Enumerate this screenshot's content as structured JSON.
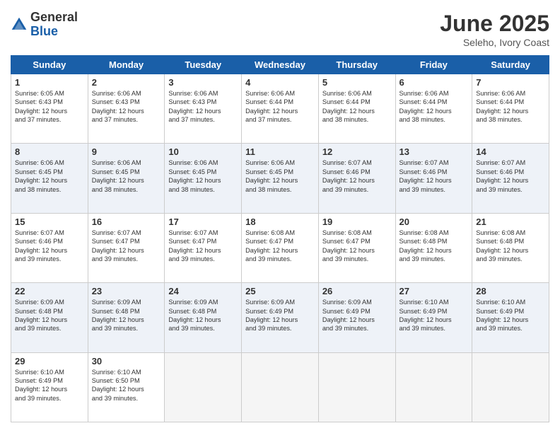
{
  "header": {
    "logo_general": "General",
    "logo_blue": "Blue",
    "month_title": "June 2025",
    "location": "Seleho, Ivory Coast"
  },
  "weekdays": [
    "Sunday",
    "Monday",
    "Tuesday",
    "Wednesday",
    "Thursday",
    "Friday",
    "Saturday"
  ],
  "weeks": [
    [
      {
        "day": "1",
        "sunrise": "6:05 AM",
        "sunset": "6:43 PM",
        "daylight": "12 hours and 37 minutes."
      },
      {
        "day": "2",
        "sunrise": "6:06 AM",
        "sunset": "6:43 PM",
        "daylight": "12 hours and 37 minutes."
      },
      {
        "day": "3",
        "sunrise": "6:06 AM",
        "sunset": "6:43 PM",
        "daylight": "12 hours and 37 minutes."
      },
      {
        "day": "4",
        "sunrise": "6:06 AM",
        "sunset": "6:44 PM",
        "daylight": "12 hours and 37 minutes."
      },
      {
        "day": "5",
        "sunrise": "6:06 AM",
        "sunset": "6:44 PM",
        "daylight": "12 hours and 38 minutes."
      },
      {
        "day": "6",
        "sunrise": "6:06 AM",
        "sunset": "6:44 PM",
        "daylight": "12 hours and 38 minutes."
      },
      {
        "day": "7",
        "sunrise": "6:06 AM",
        "sunset": "6:44 PM",
        "daylight": "12 hours and 38 minutes."
      }
    ],
    [
      {
        "day": "8",
        "sunrise": "6:06 AM",
        "sunset": "6:45 PM",
        "daylight": "12 hours and 38 minutes."
      },
      {
        "day": "9",
        "sunrise": "6:06 AM",
        "sunset": "6:45 PM",
        "daylight": "12 hours and 38 minutes."
      },
      {
        "day": "10",
        "sunrise": "6:06 AM",
        "sunset": "6:45 PM",
        "daylight": "12 hours and 38 minutes."
      },
      {
        "day": "11",
        "sunrise": "6:06 AM",
        "sunset": "6:45 PM",
        "daylight": "12 hours and 38 minutes."
      },
      {
        "day": "12",
        "sunrise": "6:07 AM",
        "sunset": "6:46 PM",
        "daylight": "12 hours and 39 minutes."
      },
      {
        "day": "13",
        "sunrise": "6:07 AM",
        "sunset": "6:46 PM",
        "daylight": "12 hours and 39 minutes."
      },
      {
        "day": "14",
        "sunrise": "6:07 AM",
        "sunset": "6:46 PM",
        "daylight": "12 hours and 39 minutes."
      }
    ],
    [
      {
        "day": "15",
        "sunrise": "6:07 AM",
        "sunset": "6:46 PM",
        "daylight": "12 hours and 39 minutes."
      },
      {
        "day": "16",
        "sunrise": "6:07 AM",
        "sunset": "6:47 PM",
        "daylight": "12 hours and 39 minutes."
      },
      {
        "day": "17",
        "sunrise": "6:07 AM",
        "sunset": "6:47 PM",
        "daylight": "12 hours and 39 minutes."
      },
      {
        "day": "18",
        "sunrise": "6:08 AM",
        "sunset": "6:47 PM",
        "daylight": "12 hours and 39 minutes."
      },
      {
        "day": "19",
        "sunrise": "6:08 AM",
        "sunset": "6:47 PM",
        "daylight": "12 hours and 39 minutes."
      },
      {
        "day": "20",
        "sunrise": "6:08 AM",
        "sunset": "6:48 PM",
        "daylight": "12 hours and 39 minutes."
      },
      {
        "day": "21",
        "sunrise": "6:08 AM",
        "sunset": "6:48 PM",
        "daylight": "12 hours and 39 minutes."
      }
    ],
    [
      {
        "day": "22",
        "sunrise": "6:09 AM",
        "sunset": "6:48 PM",
        "daylight": "12 hours and 39 minutes."
      },
      {
        "day": "23",
        "sunrise": "6:09 AM",
        "sunset": "6:48 PM",
        "daylight": "12 hours and 39 minutes."
      },
      {
        "day": "24",
        "sunrise": "6:09 AM",
        "sunset": "6:48 PM",
        "daylight": "12 hours and 39 minutes."
      },
      {
        "day": "25",
        "sunrise": "6:09 AM",
        "sunset": "6:49 PM",
        "daylight": "12 hours and 39 minutes."
      },
      {
        "day": "26",
        "sunrise": "6:09 AM",
        "sunset": "6:49 PM",
        "daylight": "12 hours and 39 minutes."
      },
      {
        "day": "27",
        "sunrise": "6:10 AM",
        "sunset": "6:49 PM",
        "daylight": "12 hours and 39 minutes."
      },
      {
        "day": "28",
        "sunrise": "6:10 AM",
        "sunset": "6:49 PM",
        "daylight": "12 hours and 39 minutes."
      }
    ],
    [
      {
        "day": "29",
        "sunrise": "6:10 AM",
        "sunset": "6:49 PM",
        "daylight": "12 hours and 39 minutes."
      },
      {
        "day": "30",
        "sunrise": "6:10 AM",
        "sunset": "6:50 PM",
        "daylight": "12 hours and 39 minutes."
      },
      null,
      null,
      null,
      null,
      null
    ]
  ]
}
